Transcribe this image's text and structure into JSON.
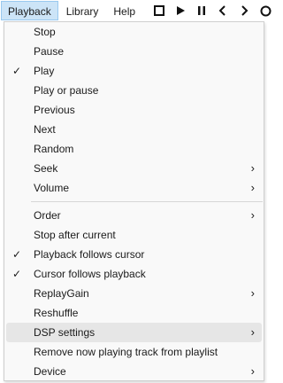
{
  "menubar": {
    "items": [
      {
        "label": "Playback"
      },
      {
        "label": "Library"
      },
      {
        "label": "Help"
      }
    ]
  },
  "toolbar": {
    "buttons": [
      {
        "icon": "stop-icon"
      },
      {
        "icon": "play-icon"
      },
      {
        "icon": "pause-icon"
      },
      {
        "icon": "previous-icon"
      },
      {
        "icon": "next-icon"
      },
      {
        "icon": "random-icon"
      }
    ]
  },
  "playback_menu": {
    "items": [
      {
        "label": "Stop",
        "checked": false,
        "submenu": false
      },
      {
        "label": "Pause",
        "checked": false,
        "submenu": false
      },
      {
        "label": "Play",
        "checked": true,
        "submenu": false
      },
      {
        "label": "Play or pause",
        "checked": false,
        "submenu": false
      },
      {
        "label": "Previous",
        "checked": false,
        "submenu": false
      },
      {
        "label": "Next",
        "checked": false,
        "submenu": false
      },
      {
        "label": "Random",
        "checked": false,
        "submenu": false
      },
      {
        "label": "Seek",
        "checked": false,
        "submenu": true
      },
      {
        "label": "Volume",
        "checked": false,
        "submenu": true
      },
      {
        "label": "Order",
        "checked": false,
        "submenu": true
      },
      {
        "label": "Stop after current",
        "checked": false,
        "submenu": false
      },
      {
        "label": "Playback follows cursor",
        "checked": true,
        "submenu": false
      },
      {
        "label": "Cursor follows playback",
        "checked": true,
        "submenu": false
      },
      {
        "label": "ReplayGain",
        "checked": false,
        "submenu": true
      },
      {
        "label": "Reshuffle",
        "checked": false,
        "submenu": false
      },
      {
        "label": "DSP settings",
        "checked": false,
        "submenu": true,
        "highlighted": true
      },
      {
        "label": "Remove now playing track from playlist",
        "checked": false,
        "submenu": false
      },
      {
        "label": "Device",
        "checked": false,
        "submenu": true
      }
    ],
    "check_glyph": "✓",
    "submenu_glyph": "›"
  }
}
